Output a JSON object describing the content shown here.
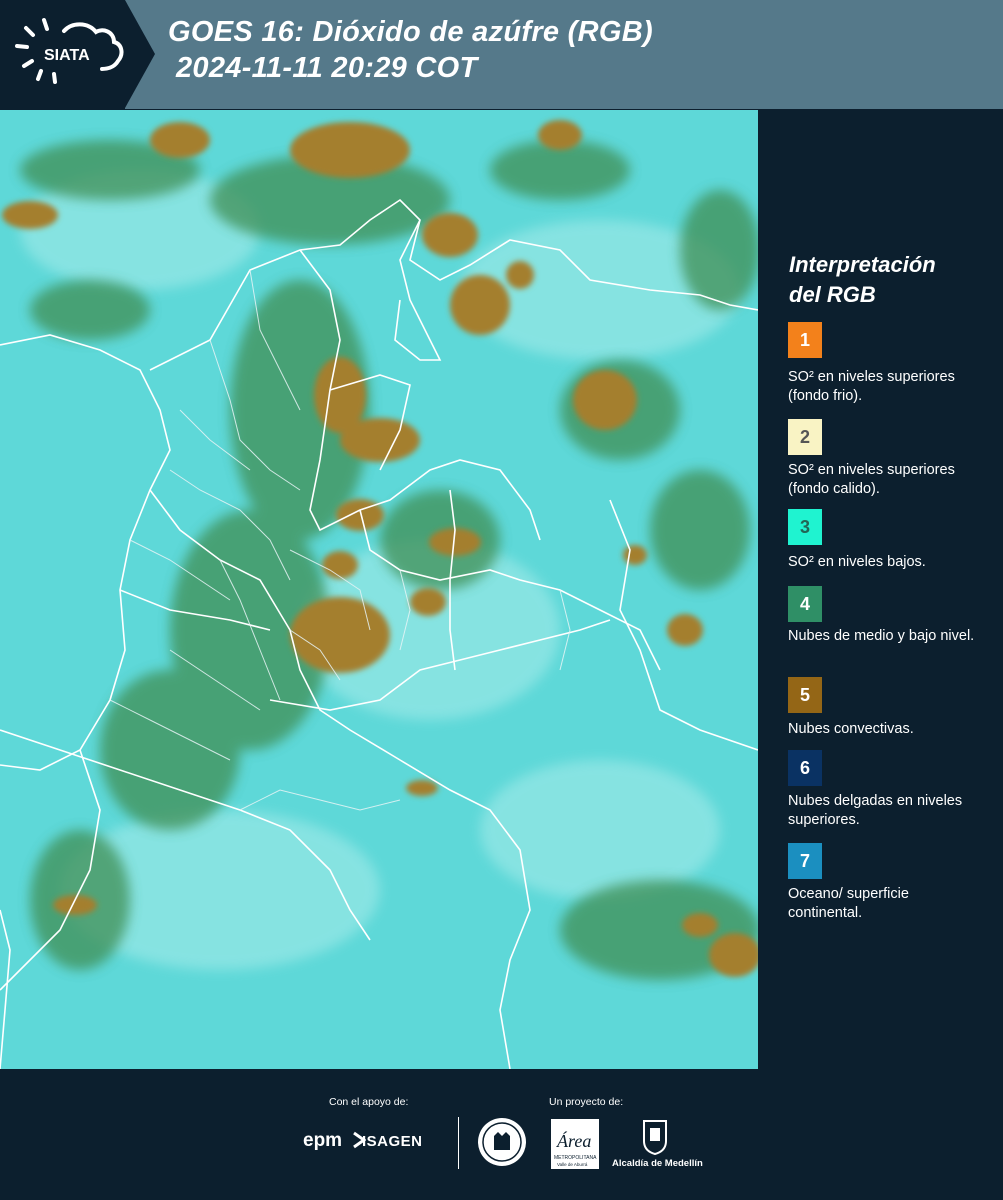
{
  "header": {
    "logo_text": "SIATA",
    "title_line1": "GOES 16: Dióxido de azúfre (RGB)",
    "title_line2": "2024-11-11 20:29 COT"
  },
  "map": {
    "colors": {
      "ocean_surface": "#5ed8d8",
      "low_mid_clouds": "#3f8f55",
      "convective": "#a47f2f",
      "borders": "#ffffff"
    }
  },
  "legend": {
    "title_line1": "Interpretación",
    "title_line2": "del RGB",
    "items": [
      {
        "number": "1",
        "color": "#f3811b",
        "text_color": "#ffffff",
        "label": "SO² en niveles superiores (fondo frio)."
      },
      {
        "number": "2",
        "color": "#f9f3c4",
        "text_color": "#555555",
        "label": "SO² en niveles superiores (fondo calido)."
      },
      {
        "number": "3",
        "color": "#1ff3d0",
        "text_color": "#226655",
        "label": "SO² en niveles bajos."
      },
      {
        "number": "4",
        "color": "#2f8f66",
        "text_color": "#ffffff",
        "label": "Nubes de medio y bajo nivel."
      },
      {
        "number": "5",
        "color": "#946616",
        "text_color": "#ffffff",
        "label": "Nubes convectivas."
      },
      {
        "number": "6",
        "color": "#0a3263",
        "text_color": "#ffffff",
        "label": "Nubes delgadas en niveles superiores."
      },
      {
        "number": "7",
        "color": "#1b8fc0",
        "text_color": "#ffffff",
        "label": "Oceano/ superficie continental."
      }
    ]
  },
  "footer": {
    "support_label": "Con el apoyo de:",
    "project_label": "Un proyecto de:",
    "sponsor1": "epm",
    "sponsor2": "ISAGEN",
    "area_logo": "Área Metropolitana Valle de Aburrá",
    "alcaldia": "Alcaldía de Medellín"
  }
}
